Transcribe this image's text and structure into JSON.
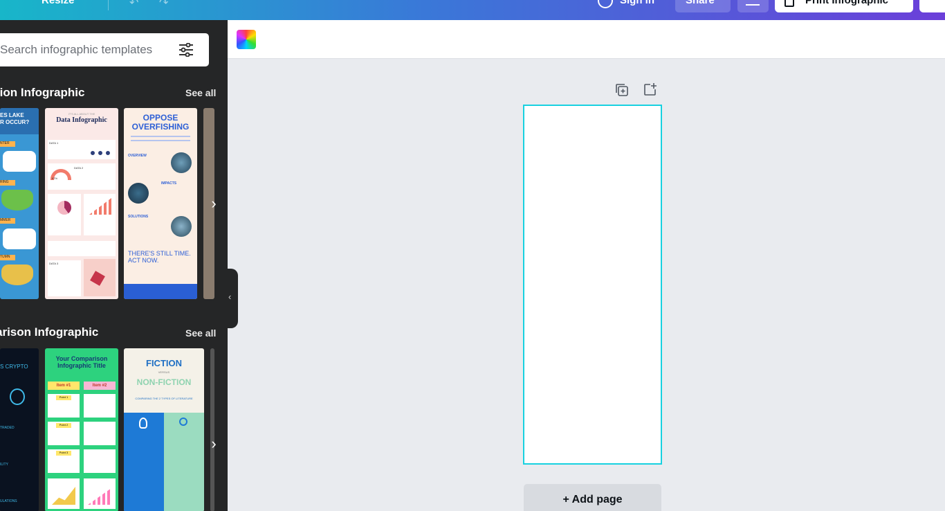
{
  "topbar": {
    "resize_label": "Resize",
    "signin_label": "Sign in",
    "share_label": "Share",
    "print_label": "Print Infographic"
  },
  "search": {
    "placeholder": "Search infographic templates"
  },
  "sections": [
    {
      "title": "tion Infographic",
      "see_all": "See all",
      "templates": [
        {
          "title_lines": [
            "ES LAKE",
            "R OCCUR?"
          ],
          "labels": [
            "NTER",
            "RING",
            "MMER",
            "TUMN"
          ]
        },
        {
          "title": "Data Infographic",
          "subtitle": "IT'S ALL ABOUT THE",
          "labels": [
            "DATA 1",
            "DATA 2",
            "DATA 3",
            "67%"
          ]
        },
        {
          "title_lines": [
            "OPPOSE",
            "OVERFISHING"
          ],
          "labels": [
            "OVERVIEW",
            "IMPACTS",
            "SOLUTIONS"
          ],
          "footer_lines": [
            "THERE'S STILL TIME.",
            "ACT NOW."
          ]
        }
      ]
    },
    {
      "title": "arison Infographic",
      "see_all": "See all",
      "templates": [
        {
          "title": "S CRYPTO",
          "labels": [
            "TRADED",
            "ILITY",
            "ULATIONS"
          ]
        },
        {
          "title_lines": [
            "Your Comparison",
            "Infographic Title"
          ],
          "labels": [
            "Item #1",
            "Item #2",
            "Point 1",
            "Point 2",
            "Point 3"
          ]
        },
        {
          "title": "FICTION",
          "versus": "VERSUS",
          "subtitle": "NON-FICTION",
          "caption": "COMPARING THE 2 TYPES OF LITERATURE"
        }
      ]
    }
  ],
  "editor": {
    "add_page_label": "+ Add page"
  },
  "colors": {
    "accent": "#17d1e0",
    "panel_bg": "#252627",
    "canvas_bg": "#e9ebef"
  }
}
